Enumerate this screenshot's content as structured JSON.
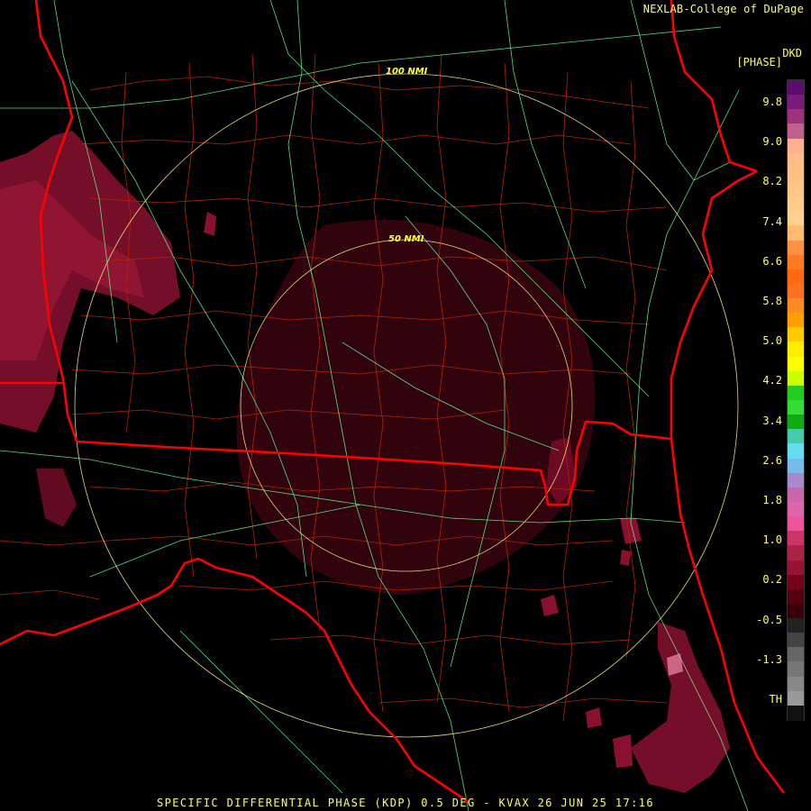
{
  "header": {
    "credit": "NEXLAB-College of DuPage",
    "product_code": "DKD",
    "units": "[PHASE]"
  },
  "range_rings": [
    {
      "label": "100 NMI"
    },
    {
      "label": "50 NMI"
    }
  ],
  "legend": {
    "ticks": [
      "9.8",
      "9.0",
      "8.2",
      "7.4",
      "6.6",
      "5.8",
      "5.0",
      "4.2",
      "3.4",
      "2.6",
      "1.8",
      "1.0",
      "0.2",
      "-0.5",
      "-1.3",
      "TH"
    ],
    "colors": [
      "#5a0d6e",
      "#7a1a7a",
      "#a0307a",
      "#c06090",
      "#ffb090",
      "#ffbb88",
      "#ffc080",
      "#ffc585",
      "#ffcc88",
      "#ffd090",
      "#ffbb70",
      "#ff9040",
      "#ff7a20",
      "#ff6a10",
      "#ff7020",
      "#ff8a20",
      "#ffa000",
      "#ffcc00",
      "#ffee00",
      "#ffff00",
      "#ccff00",
      "#22cc22",
      "#33dd33",
      "#11aa11",
      "#44ccaa",
      "#66ddee",
      "#77bbee",
      "#aa88cc",
      "#cc66aa",
      "#dd66aa",
      "#ee5599",
      "#cc3366",
      "#aa2244",
      "#991133",
      "#77001a",
      "#550011",
      "#3a0008",
      "#222222",
      "#444444",
      "#666666",
      "#777777",
      "#888888",
      "#999999",
      "#111111"
    ]
  },
  "colors": {
    "state_border": "#ff0000",
    "county_border": "#b82000",
    "highway": "#66ff99",
    "range_ring": "#ffee88",
    "echo_dark": "#6a0820",
    "echo_mid": "#8a1030",
    "echo_light": "#cc6688"
  },
  "footer": {
    "caption": "SPECIFIC DIFFERENTIAL PHASE (KDP) 0.5 DEG - KVAX 26 JUN 25 17:16"
  }
}
